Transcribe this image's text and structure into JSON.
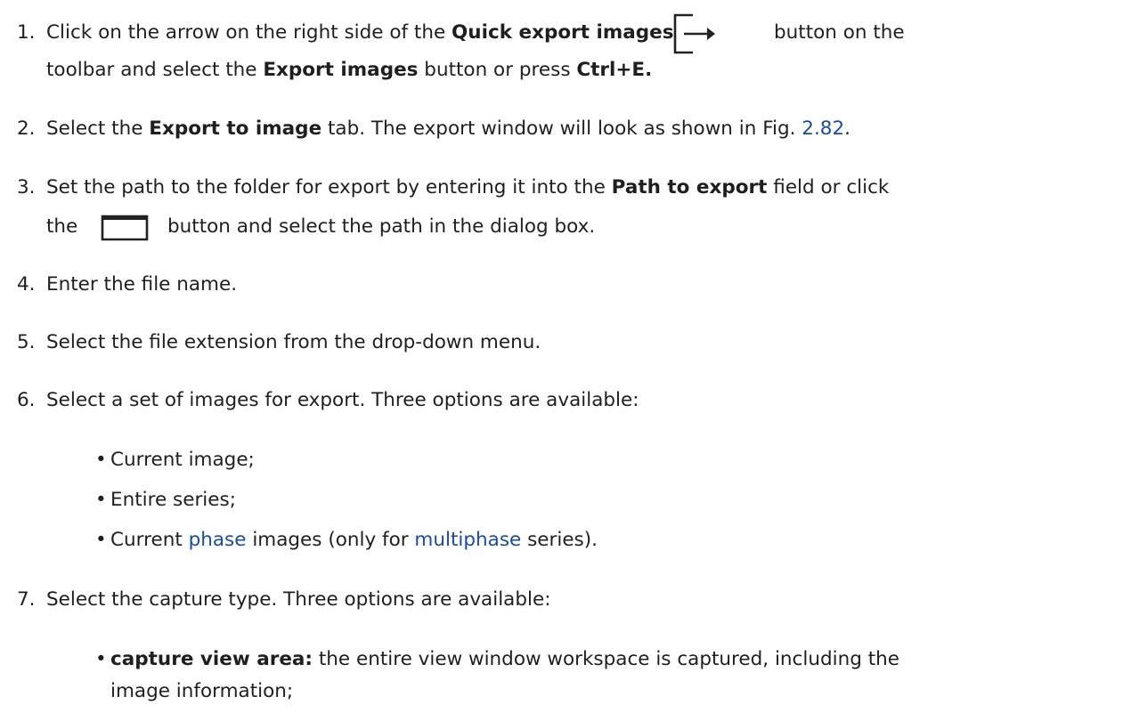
{
  "steps": [
    {
      "number": "1.",
      "line1": {
        "pre": "Click on the arrow on the right side of the ",
        "bold1": "Quick export images",
        "post": "button on the"
      },
      "line2": {
        "pre": "toolbar and select the ",
        "bold1": "Export images",
        "mid": " button or press ",
        "bold2": "Ctrl+E."
      }
    },
    {
      "number": "2.",
      "line1": {
        "pre": "Select the ",
        "bold1": "Export to image",
        "mid": " tab. The export window will look as shown in Fig. ",
        "link": "2.82",
        "post": "."
      }
    },
    {
      "number": "3.",
      "line1": {
        "pre": "Set the path to the folder for export by entering it into the ",
        "bold1": "Path to export",
        "post": " field or click"
      },
      "line2": {
        "pre": "the",
        "post": "button and select the path in the dialog box."
      }
    },
    {
      "number": "4.",
      "text": "Enter the file name."
    },
    {
      "number": "5.",
      "text": "Select the file extension from the drop-down menu."
    },
    {
      "number": "6.",
      "text": "Select a set of images for export. Three options are available:",
      "options": [
        {
          "text": "Current image;"
        },
        {
          "text": "Entire series;"
        },
        {
          "pre": "Current ",
          "link1": "phase",
          "mid": " images (only for ",
          "link2": "multiphase",
          "post": " series)."
        }
      ]
    },
    {
      "number": "7.",
      "text": "Select the capture type. Three options are available:",
      "options": [
        {
          "bold": "capture view area:",
          "line1": " the entire view window workspace is captured, including the",
          "line2": "image information;"
        }
      ]
    }
  ],
  "icons": {
    "export": "quick-export-icon",
    "folder": "folder-icon"
  },
  "colors": {
    "link": "#1a4ba8",
    "text": "#1f1f1f"
  }
}
